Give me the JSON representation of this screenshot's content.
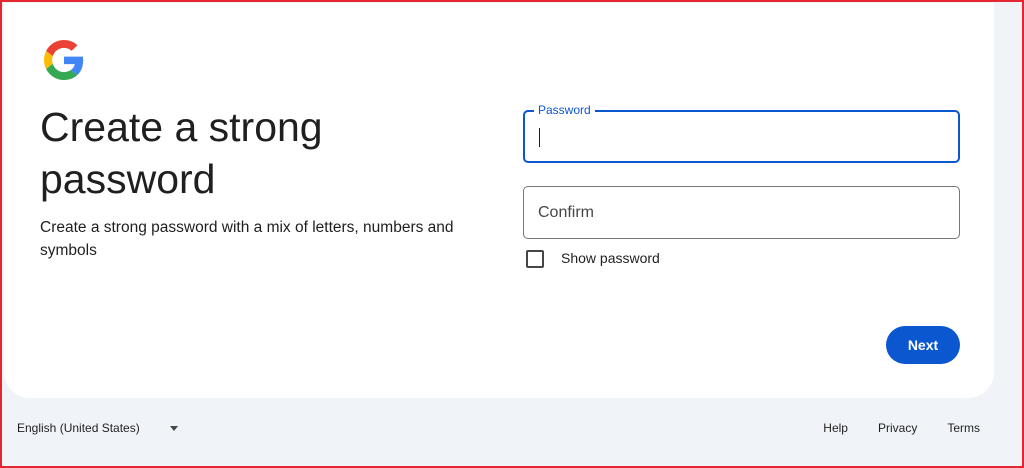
{
  "brand": {
    "logo_icon": "google-g-icon",
    "colors": {
      "blue": "#4285F4",
      "red": "#EA4335",
      "yellow": "#FBBC05",
      "green": "#34A853"
    }
  },
  "heading": {
    "title": "Create a strong password",
    "subtitle": "Create a strong password with a mix of letters, numbers and symbols"
  },
  "form": {
    "password": {
      "label": "Password",
      "value": "",
      "state": "focused"
    },
    "confirm": {
      "placeholder": "Confirm",
      "value": ""
    },
    "show_password": {
      "label": "Show password",
      "checked": false
    },
    "next_label": "Next"
  },
  "footer": {
    "language": "English (United States)",
    "links": [
      "Help",
      "Privacy",
      "Terms"
    ]
  },
  "colors": {
    "accent": "#0b57d0",
    "page_bg": "#f0f4f9",
    "frame": "#e3262f"
  }
}
